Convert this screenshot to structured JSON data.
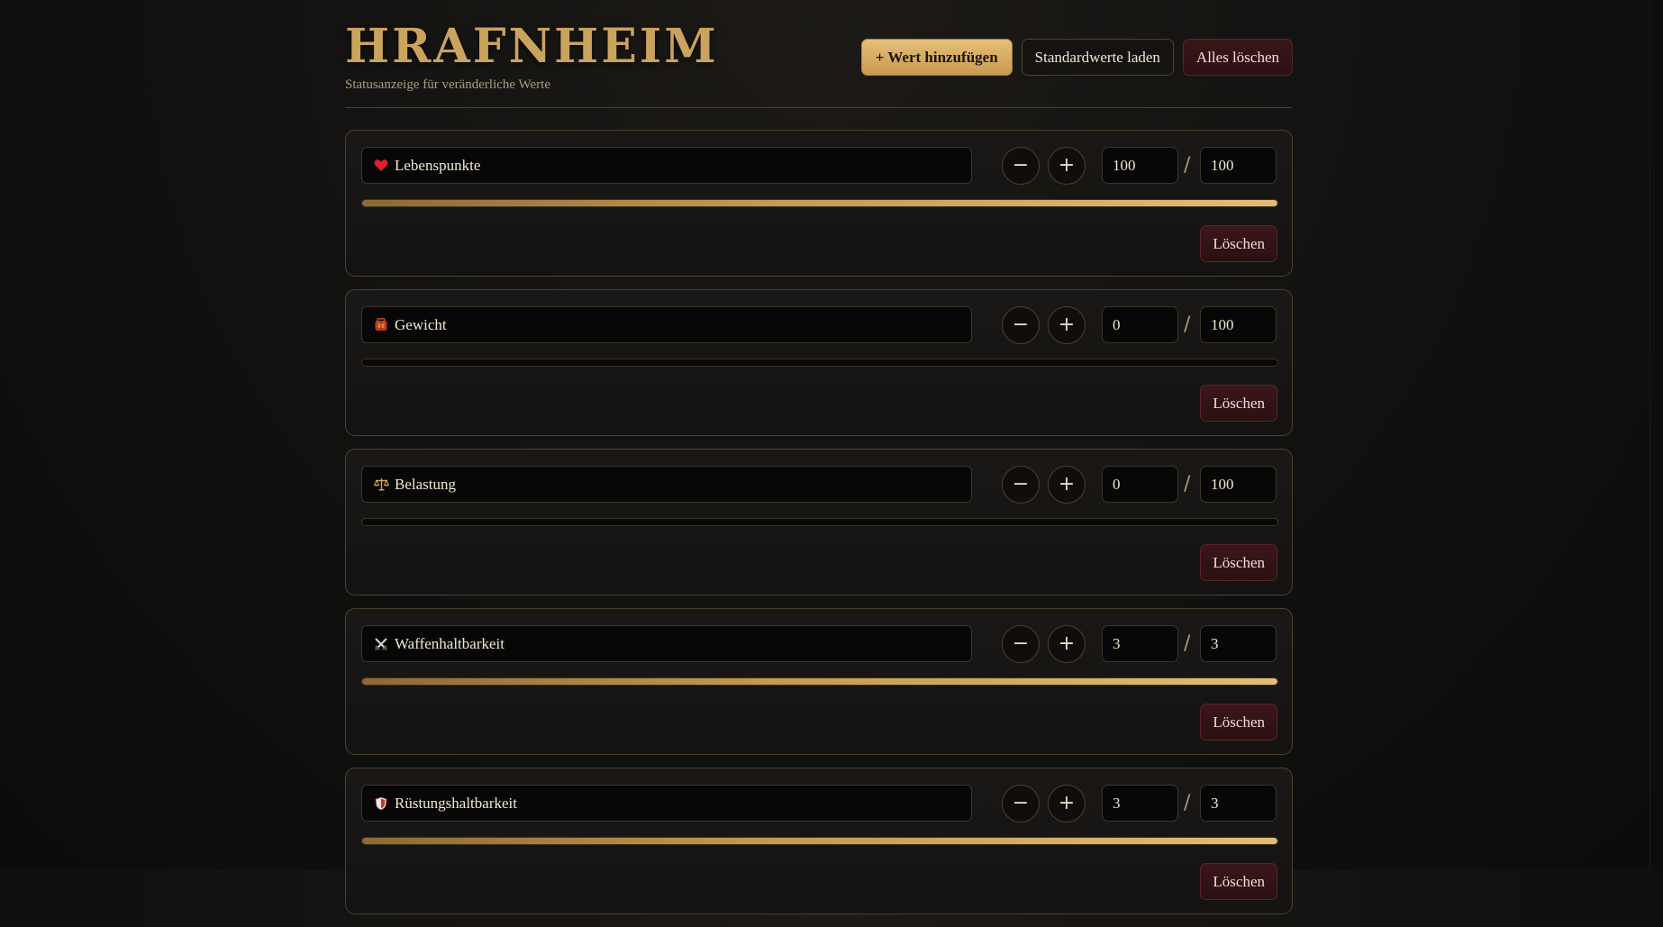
{
  "header": {
    "title": "HRAFNHEIM",
    "subtitle": "Statusanzeige für veränderliche Werte",
    "add_label": "+ Wert hinzufügen",
    "defaults_label": "Standardwerte laden",
    "clear_label": "Alles löschen"
  },
  "cards": [
    {
      "icon": "heart-icon",
      "name": "Lebenspunkte",
      "current": "100",
      "max": "100",
      "fill_fraction": 1.0,
      "delete_label": "Löschen"
    },
    {
      "icon": "backpack-icon",
      "name": "Gewicht",
      "current": "0",
      "max": "100",
      "fill_fraction": 0.0,
      "delete_label": "Löschen"
    },
    {
      "icon": "scales-icon",
      "name": "Belastung",
      "current": "0",
      "max": "100",
      "fill_fraction": 0.0,
      "delete_label": "Löschen"
    },
    {
      "icon": "crossed-swords-icon",
      "name": "Waffenhaltbarkeit",
      "current": "3",
      "max": "3",
      "fill_fraction": 1.0,
      "delete_label": "Löschen"
    },
    {
      "icon": "shield-icon",
      "name": "Rüstungshaltbarkeit",
      "current": "3",
      "max": "3",
      "fill_fraction": 1.0,
      "delete_label": "Löschen"
    }
  ],
  "controls": {
    "minus_symbol": "−",
    "plus_symbol": "+",
    "separator": "/"
  },
  "colors": {
    "accent_gold": "#caa35e",
    "danger": "#3b1719",
    "heart": "#e0202e"
  }
}
